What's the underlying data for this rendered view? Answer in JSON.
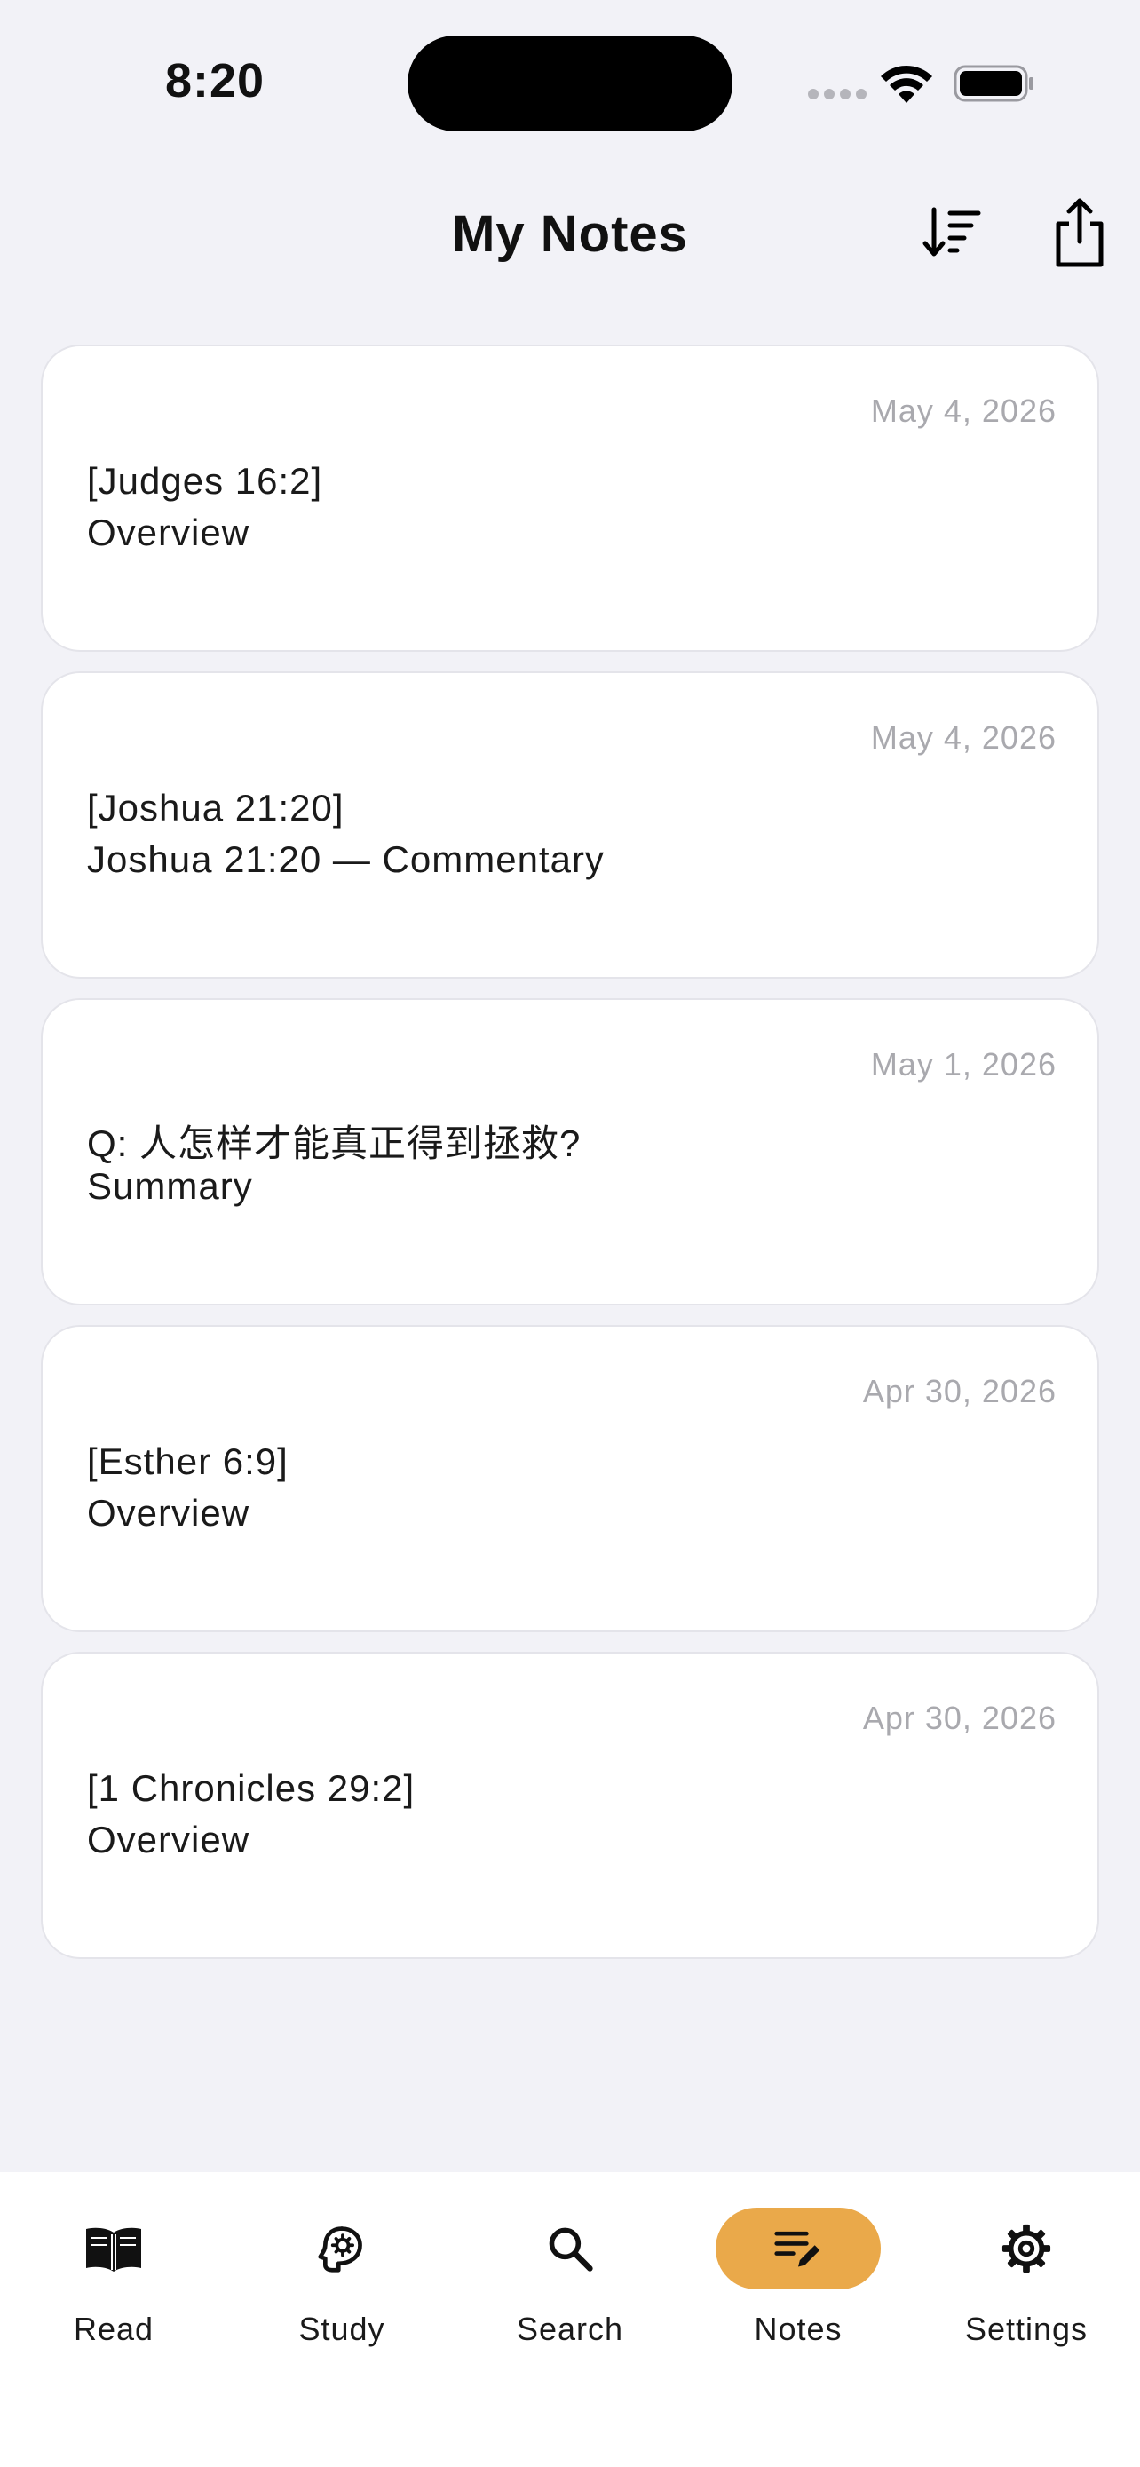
{
  "status_bar": {
    "time": "8:20"
  },
  "header": {
    "title": "My Notes",
    "sort_icon": "sort-descending-icon",
    "share_icon": "share-icon"
  },
  "notes": [
    {
      "date": "May 4, 2026",
      "title": "[Judges 16:2]",
      "subtitle": "Overview"
    },
    {
      "date": "May 4, 2026",
      "title": "[Joshua 21:20]",
      "subtitle": "Joshua 21:20 — Commentary"
    },
    {
      "date": "May 1, 2026",
      "title": "Q: 人怎样才能真正得到拯救?",
      "subtitle": "Summary"
    },
    {
      "date": "Apr 30, 2026",
      "title": "[Esther 6:9]",
      "subtitle": "Overview"
    },
    {
      "date": "Apr 30, 2026",
      "title": "[1 Chronicles 29:2]",
      "subtitle": "Overview"
    }
  ],
  "tab_bar": {
    "tabs": [
      {
        "label": "Read",
        "icon": "book-icon",
        "active": false
      },
      {
        "label": "Study",
        "icon": "brain-icon",
        "active": false
      },
      {
        "label": "Search",
        "icon": "search-icon",
        "active": false
      },
      {
        "label": "Notes",
        "icon": "notes-edit-icon",
        "active": true
      },
      {
        "label": "Settings",
        "icon": "gear-icon",
        "active": false
      }
    ],
    "active_color": "#eaa94a"
  }
}
